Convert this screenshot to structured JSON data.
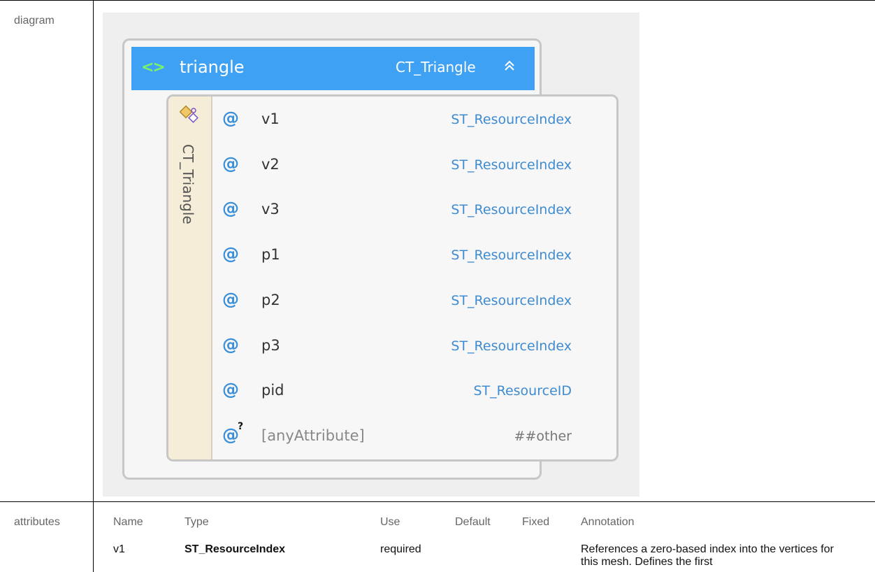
{
  "labels": {
    "diagram": "diagram",
    "attributes": "attributes"
  },
  "element": {
    "name": "triangle",
    "type": "CT_Triangle",
    "icon": "element-brackets-icon",
    "collapse_icon": "double-chevron-up-icon",
    "collapse_glyph": "≈"
  },
  "complex_type": {
    "name": "CT_Triangle",
    "icon": "complex-type-icon"
  },
  "attributes": [
    {
      "name": "v1",
      "type": "ST_ResourceIndex",
      "any": false
    },
    {
      "name": "v2",
      "type": "ST_ResourceIndex",
      "any": false
    },
    {
      "name": "v3",
      "type": "ST_ResourceIndex",
      "any": false
    },
    {
      "name": "p1",
      "type": "ST_ResourceIndex",
      "any": false
    },
    {
      "name": "p2",
      "type": "ST_ResourceIndex",
      "any": false
    },
    {
      "name": "p3",
      "type": "ST_ResourceIndex",
      "any": false
    },
    {
      "name": "pid",
      "type": "ST_ResourceID",
      "any": false
    },
    {
      "name": "[anyAttribute]",
      "type": "##other",
      "any": true
    }
  ],
  "attributes_table": {
    "headers": [
      "Name",
      "Type",
      "Use",
      "Default",
      "Fixed",
      "Annotation"
    ],
    "rows": [
      {
        "name": "v1",
        "type": "ST_ResourceIndex",
        "use": "required",
        "default": "",
        "fixed": "",
        "annotation": "References a zero-based index into the vertices for this mesh. Defines the first"
      }
    ]
  },
  "colors": {
    "header_blue": "#3fa1f4",
    "element_icon_green": "#7cf36a",
    "type_link_blue": "#3f8bd1",
    "strip_beige": "#f5edd8"
  }
}
